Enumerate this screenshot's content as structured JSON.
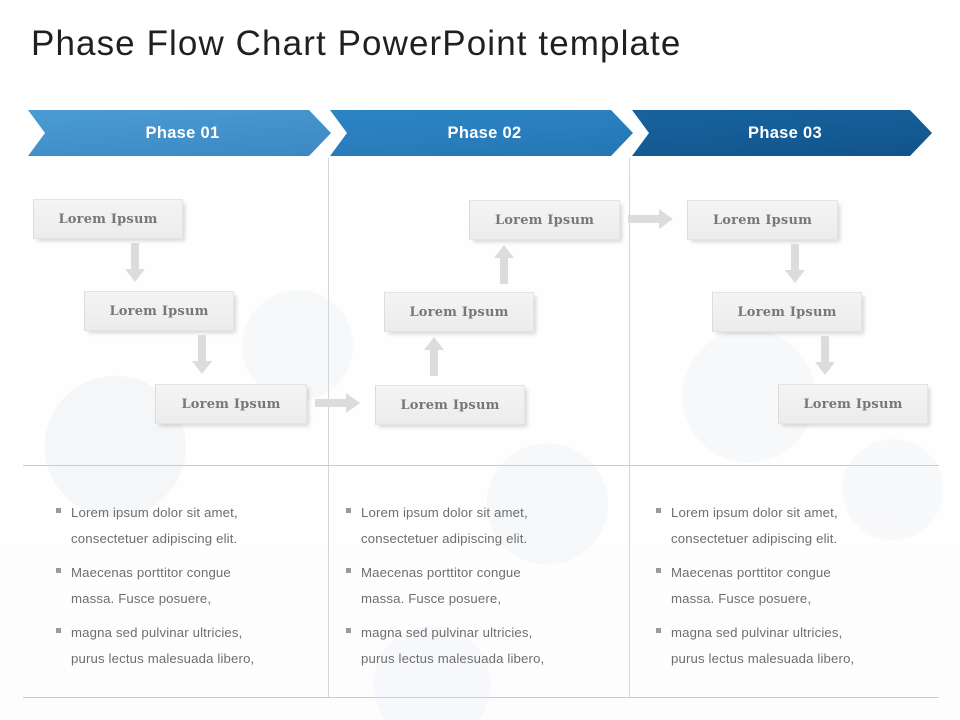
{
  "slide": {
    "title": "Phase Flow Chart PowerPoint template",
    "background_color": "#ffffff"
  },
  "phases": [
    {
      "banner_label": "Phase 01",
      "banner_color": "#4593cd",
      "flow_direction": "downward",
      "steps": [
        {
          "label": "Lorem Ipsum"
        },
        {
          "label": "Lorem Ipsum"
        },
        {
          "label": "Lorem Ipsum"
        }
      ],
      "bullets": [
        "Lorem ipsum dolor sit amet,\nconsectetuer adipiscing  elit.",
        "Maecenas porttitor congue\nmassa. Fusce posuere,",
        "magna sed pulvinar  ultricies,\npurus lectus malesuada libero,"
      ]
    },
    {
      "banner_label": "Phase 02",
      "banner_color": "#2a7fbe",
      "flow_direction": "upward",
      "steps": [
        {
          "label": "Lorem Ipsum"
        },
        {
          "label": "Lorem Ipsum"
        },
        {
          "label": "Lorem Ipsum"
        }
      ],
      "bullets": [
        "Lorem ipsum dolor sit amet,\nconsectetuer adipiscing  elit.",
        "Maecenas porttitor congue\nmassa. Fusce posuere,",
        "magna sed pulvinar  ultricies,\npurus lectus malesuada libero,"
      ]
    },
    {
      "banner_label": "Phase 03",
      "banner_color": "#155d97",
      "flow_direction": "downward",
      "steps": [
        {
          "label": "Lorem Ipsum"
        },
        {
          "label": "Lorem Ipsum"
        },
        {
          "label": "Lorem Ipsum"
        }
      ],
      "bullets": [
        "Lorem ipsum dolor sit amet,\nconsectetuer adipiscing  elit.",
        "Maecenas porttitor congue\nmassa. Fusce posuere,",
        "magna sed pulvinar  ultricies,\npurus lectus malesuada libero,"
      ]
    }
  ],
  "connectors": {
    "arrow_color": "#dcdcdc",
    "phase1_to_phase2": "arrow-right-icon",
    "phase2_to_phase3": "arrow-right-icon"
  }
}
